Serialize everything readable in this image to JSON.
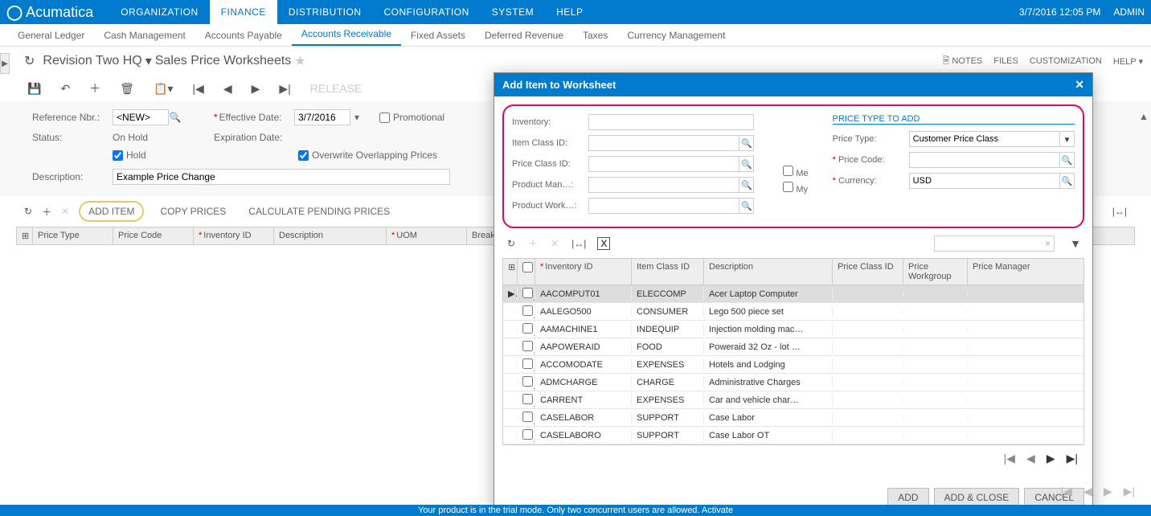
{
  "topbar": {
    "brand": "Acumatica",
    "items": [
      "ORGANIZATION",
      "FINANCE",
      "DISTRIBUTION",
      "CONFIGURATION",
      "SYSTEM",
      "HELP"
    ],
    "active": 1,
    "date": "3/7/2016  12:05 PM",
    "user": "ADMIN"
  },
  "subnav": {
    "items": [
      "General Ledger",
      "Cash Management",
      "Accounts Payable",
      "Accounts Receivable",
      "Fixed Assets",
      "Deferred Revenue",
      "Taxes",
      "Currency Management"
    ],
    "active": 3
  },
  "breadcrumb": {
    "company": "Revision Two HQ",
    "page": "Sales Price Worksheets"
  },
  "titleActions": {
    "notes": "NOTES",
    "files": "FILES",
    "customization": "CUSTOMIZATION",
    "help": "HELP"
  },
  "toolbar": {
    "release": "RELEASE"
  },
  "form": {
    "refLabel": "Reference Nbr.:",
    "refValue": "<NEW>",
    "statusLabel": "Status:",
    "statusValue": "On Hold",
    "holdLabel": "Hold",
    "effDateLabel": "Effective Date:",
    "effDateValue": "3/7/2016",
    "expDateLabel": "Expiration Date:",
    "promoLabel": "Promotional",
    "overwriteLabel": "Overwrite Overlapping Prices",
    "descLabel": "Description:",
    "descValue": "Example Price Change"
  },
  "gridToolbar": {
    "addItem": "ADD ITEM",
    "copyPrices": "COPY PRICES",
    "calcPending": "CALCULATE PENDING PRICES"
  },
  "gridCols": [
    "Price Type",
    "Price Code",
    "Inventory ID",
    "Description",
    "UOM",
    "Break"
  ],
  "dialog": {
    "title": "Add Item to Worksheet",
    "filters": {
      "inventoryLabel": "Inventory:",
      "itemClassLabel": "Item Class ID:",
      "priceClassLabel": "Price Class ID:",
      "prodManLabel": "Product Man…:",
      "prodWorkLabel": "Product Work…:",
      "meLabel": "Me",
      "myLabel": "My",
      "priceSection": "PRICE TYPE TO ADD",
      "priceTypeLabel": "Price Type:",
      "priceTypeValue": "Customer Price Class",
      "priceCodeLabel": "Price Code:",
      "currencyLabel": "Currency:",
      "currencyValue": "USD"
    },
    "gridCols": {
      "inv": "Inventory ID",
      "cls": "Item Class ID",
      "desc": "Description",
      "pcls": "Price Class ID",
      "pwg": "Price Workgroup",
      "pmgr": "Price Manager"
    },
    "rows": [
      {
        "inv": "AACOMPUT01",
        "cls": "ELECCOMP",
        "desc": "Acer Laptop Computer"
      },
      {
        "inv": "AALEGO500",
        "cls": "CONSUMER",
        "desc": "Lego 500 piece set"
      },
      {
        "inv": "AAMACHINE1",
        "cls": "INDEQUIP",
        "desc": "Injection molding mac…"
      },
      {
        "inv": "AAPOWERAID",
        "cls": "FOOD",
        "desc": "Poweraid 32 Oz - lot …"
      },
      {
        "inv": "ACCOMODATE",
        "cls": "EXPENSES",
        "desc": "Hotels and Lodging"
      },
      {
        "inv": "ADMCHARGE",
        "cls": "CHARGE",
        "desc": "Administrative Charges"
      },
      {
        "inv": "CARRENT",
        "cls": "EXPENSES",
        "desc": "Car and vehicle char…"
      },
      {
        "inv": "CASELABOR",
        "cls": "SUPPORT",
        "desc": "Case Labor"
      },
      {
        "inv": "CASELABORO",
        "cls": "SUPPORT",
        "desc": "Case Labor OT"
      }
    ],
    "buttons": {
      "add": "ADD",
      "addClose": "ADD & CLOSE",
      "cancel": "CANCEL"
    }
  },
  "footerMsg": "Your product is in the trial mode. Only two concurrent users are allowed. Activate"
}
